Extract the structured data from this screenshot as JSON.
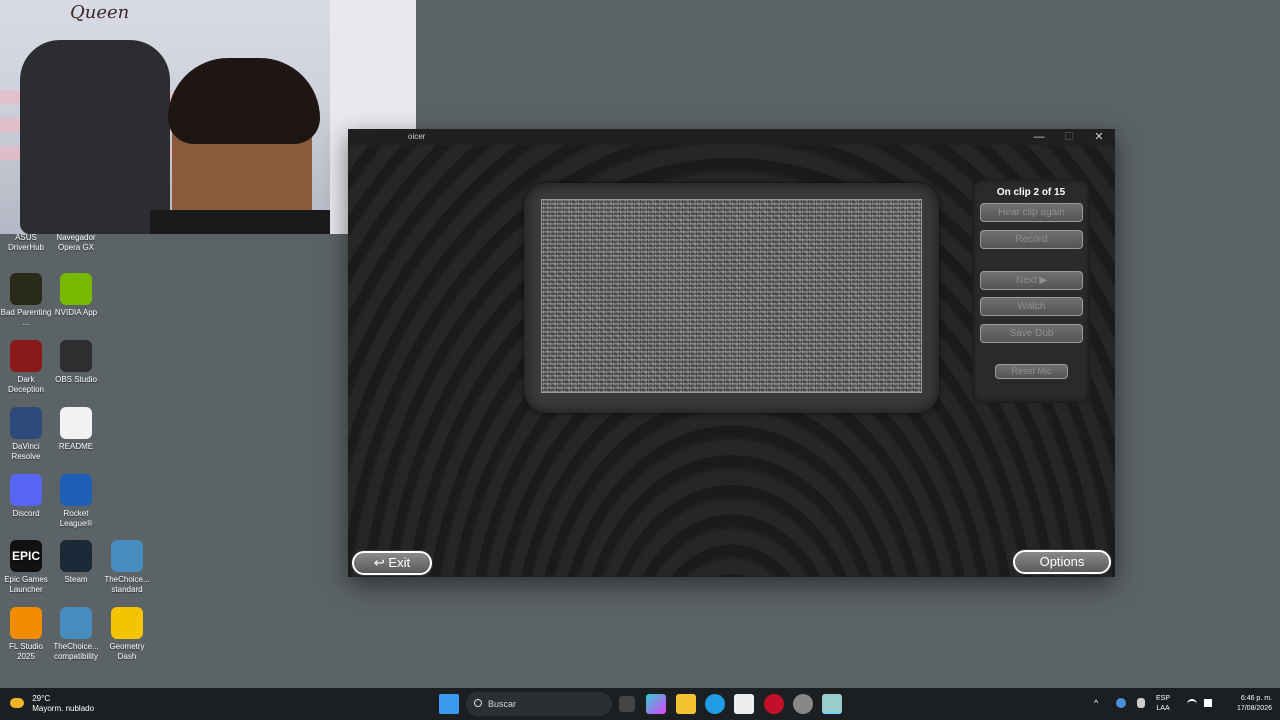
{
  "desktop_icons": [
    {
      "id": "asus",
      "label": "ASUS DriverHub",
      "color": "#0a3d8f",
      "glyph": ""
    },
    {
      "id": "opera",
      "label": "Navegador Opera GX",
      "color": "#b0122a",
      "glyph": ""
    },
    {
      "id": "bad-parenting",
      "label": "Bad Parenting ...",
      "color": "#2a2a1a",
      "glyph": ""
    },
    {
      "id": "nvidia",
      "label": "NVIDIA App",
      "color": "#76b900",
      "glyph": ""
    },
    {
      "id": "dark-deception",
      "label": "Dark Deception",
      "color": "#8a1a1a",
      "glyph": ""
    },
    {
      "id": "obs",
      "label": "OBS Studio",
      "color": "#302e31",
      "glyph": ""
    },
    {
      "id": "davinci",
      "label": "DaVinci Resolve",
      "color": "#2e4a7a",
      "glyph": ""
    },
    {
      "id": "readme",
      "label": "README",
      "color": "#f2f2f2",
      "glyph": ""
    },
    {
      "id": "discord",
      "label": "Discord",
      "color": "#5865f2",
      "glyph": ""
    },
    {
      "id": "rocket-league",
      "label": "Rocket League®",
      "color": "#1c5fb5",
      "glyph": ""
    },
    {
      "id": "epic",
      "label": "Epic Games Launcher",
      "color": "#111111",
      "glyph": "EPIC"
    },
    {
      "id": "steam",
      "label": "Steam",
      "color": "#1b2838",
      "glyph": ""
    },
    {
      "id": "thechoice-standard",
      "label": "TheChoice... standard",
      "color": "#478cbf",
      "glyph": ""
    },
    {
      "id": "fl-studio",
      "label": "FL Studio 2025",
      "color": "#f28c00",
      "glyph": ""
    },
    {
      "id": "thechoice-compat",
      "label": "TheChoice... compatibility",
      "color": "#478cbf",
      "glyph": ""
    },
    {
      "id": "geometry-dash",
      "label": "Geometry Dash",
      "color": "#f5c400",
      "glyph": ""
    }
  ],
  "webcam": {
    "wall_text": "Queen"
  },
  "window": {
    "title": "oicer",
    "controls": {
      "minimize": "—",
      "maximize": "☐",
      "close": "✕"
    },
    "panel": {
      "clip_status": "On clip 2 of 15",
      "hear_clip_again": "Hear clip again",
      "record": "Record",
      "next": "Next ▶",
      "watch": "Watch",
      "save_dub": "Save Dub",
      "reset_mic": "Reset Mic"
    },
    "exit_label": "↩ Exit",
    "options_label": "Options"
  },
  "taskbar": {
    "weather_temp": "29°C",
    "weather_desc": "Mayorm. nublado",
    "search_placeholder": "Buscar",
    "language": "ESP",
    "language_sub": "LAA",
    "time": "6:46 p. m.",
    "date": "17/08/2026"
  }
}
